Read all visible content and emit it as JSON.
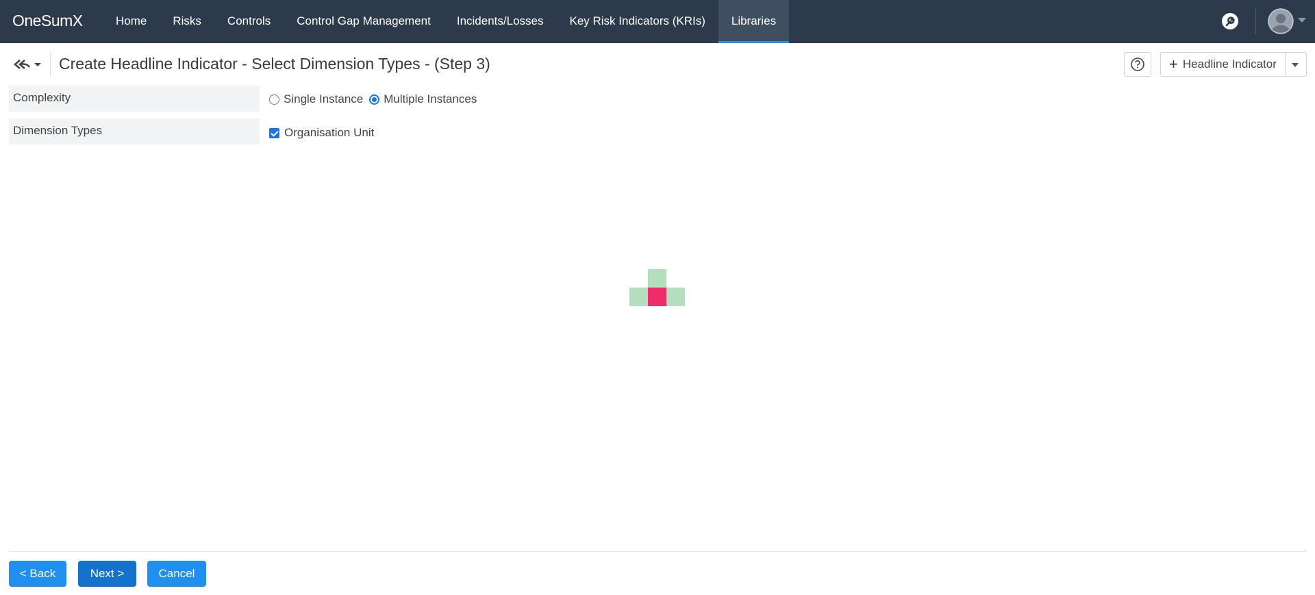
{
  "app": {
    "brand": "OneSumX"
  },
  "nav": {
    "items": [
      {
        "label": "Home"
      },
      {
        "label": "Risks"
      },
      {
        "label": "Controls"
      },
      {
        "label": "Control Gap Management"
      },
      {
        "label": "Incidents/Losses"
      },
      {
        "label": "Key Risk Indicators (KRIs)"
      },
      {
        "label": "Libraries",
        "active": true
      }
    ],
    "icons": [
      "settings-tool-icon",
      "user-avatar-icon",
      "chevron-down-icon"
    ]
  },
  "page": {
    "title": "Create Headline Indicator - Select Dimension Types - (Step 3)",
    "add_button_label": "Headline Indicator",
    "help_icon": "question-circle-icon",
    "back_history_icon": "double-back-arrow-icon"
  },
  "form": {
    "complexity": {
      "label": "Complexity",
      "options": [
        {
          "label": "Single Instance",
          "selected": false
        },
        {
          "label": "Multiple Instances",
          "selected": true
        }
      ]
    },
    "dimension_types": {
      "label": "Dimension Types",
      "options": [
        {
          "label": "Organisation Unit",
          "checked": true
        }
      ]
    }
  },
  "loader": {
    "colors": {
      "idle": "#b3dfbd",
      "active": "#ec2d6a"
    }
  },
  "footer": {
    "back_label": "< Back",
    "next_label": "Next >",
    "cancel_label": "Cancel"
  },
  "colors": {
    "nav_bg": "#2c3a4b",
    "accent": "#1f8ff0",
    "primary": "#1373cc"
  }
}
